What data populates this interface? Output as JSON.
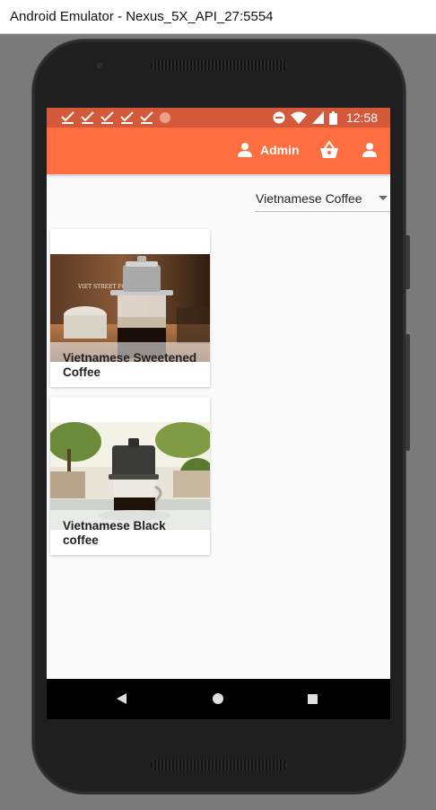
{
  "window": {
    "title": "Android Emulator - Nexus_5X_API_27:5554"
  },
  "statusbar": {
    "time": "12:58"
  },
  "appbar": {
    "user_label": "Admin"
  },
  "filter": {
    "selected": "Vietnamese Coffee"
  },
  "products": [
    {
      "name": "Vietnamese Sweetened Coffee",
      "image_watermark": "VIET STREET FOODS"
    },
    {
      "name": "Vietnamese Black coffee"
    }
  ],
  "colors": {
    "appbar": "#ff6e40",
    "statusbar": "#d4593a"
  },
  "icons": [
    "check-icon",
    "circle-icon",
    "dnd-icon",
    "wifi-icon",
    "signal-icon",
    "battery-icon",
    "person-icon",
    "basket-icon",
    "back-icon",
    "home-icon",
    "recents-icon"
  ]
}
